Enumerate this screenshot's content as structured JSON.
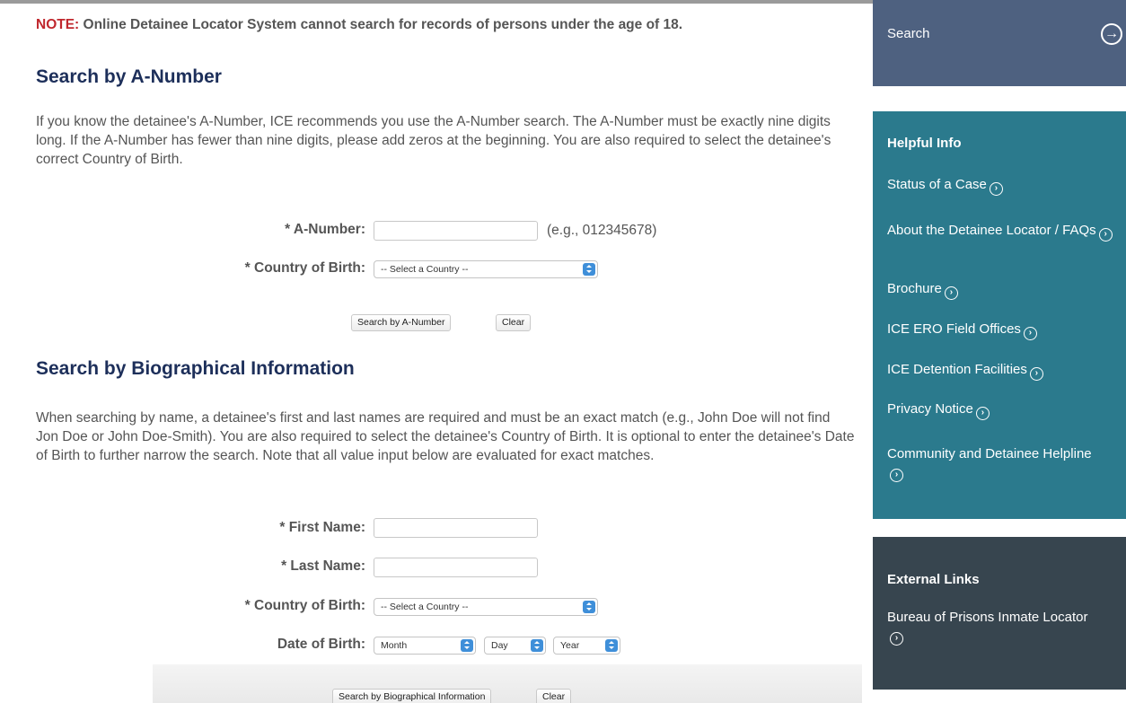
{
  "note": {
    "prefix": "NOTE:",
    "text": " Online Detainee Locator System cannot search for records of persons under the age of 18."
  },
  "anumber_section": {
    "heading": "Search by A-Number",
    "description": "If you know the detainee's A-Number, ICE recommends you use the A-Number search. The A-Number must be exactly nine digits long. If the A-Number has fewer than nine digits, please add zeros at the beginning. You are also required to select the detainee's correct Country of Birth.",
    "anumber_label": "* A-Number:",
    "anumber_value": "",
    "anumber_hint": "(e.g., 012345678)",
    "country_label": "* Country of Birth:",
    "country_selected": "-- Select a Country --",
    "search_button": "Search by A-Number",
    "clear_button": "Clear"
  },
  "bio_section": {
    "heading": "Search by Biographical Information",
    "description": "When searching by name, a detainee's first and last names are required and must be an exact match (e.g., John Doe will not find Jon Doe or John Doe-Smith). You are also required to select the detainee's Country of Birth. It is optional to enter the detainee's Date of Birth to further narrow the search. Note that all value input below are evaluated for exact matches.",
    "first_name_label": "* First Name:",
    "first_name_value": "",
    "last_name_label": "* Last Name:",
    "last_name_value": "",
    "country_label": "* Country of Birth:",
    "country_selected": "-- Select a Country --",
    "dob_label": "Date of Birth:",
    "dob_month": "Month",
    "dob_day": "Day",
    "dob_year": "Year",
    "search_button": "Search by Biographical Information",
    "clear_button": "Clear"
  },
  "sidebar": {
    "search_label": "Search",
    "search_icon": "circle-arrow-right-icon",
    "helpful_heading": "Helpful Info",
    "helpful_links": [
      "Status of a Case",
      "About the Detainee Locator / FAQs",
      "Brochure",
      "ICE ERO Field Offices",
      "ICE Detention Facilities",
      "Privacy Notice",
      "Community and Detainee Helpline"
    ],
    "external_heading": "External Links",
    "external_links": [
      "Bureau of Prisons Inmate Locator"
    ],
    "colors": {
      "search_bg": "#4e6180",
      "helpful_bg": "#2b7a8d",
      "external_bg": "#37454f"
    }
  },
  "colors": {
    "heading": "#1d2f5a",
    "note_prefix": "#c0272d",
    "select_arrow": "#3f8fd9"
  }
}
